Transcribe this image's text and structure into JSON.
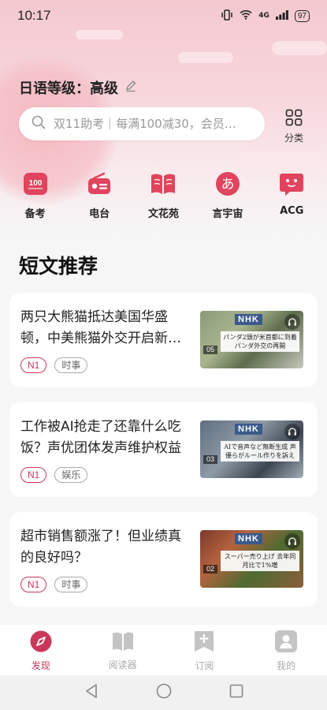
{
  "status_bar": {
    "time": "10:17",
    "network": "4G",
    "battery": "97"
  },
  "level": {
    "label": "日语等级：高级"
  },
  "search": {
    "placeholder": "双11助考｜每满100减30，会员…"
  },
  "category_button": {
    "label": "分类"
  },
  "quick_actions": [
    {
      "label": "备考",
      "icon": "exam-100-icon",
      "glyph": "100"
    },
    {
      "label": "电台",
      "icon": "radio-icon"
    },
    {
      "label": "文花苑",
      "icon": "book-icon"
    },
    {
      "label": "言宇宙",
      "icon": "hiragana-a-icon",
      "glyph": "あ"
    },
    {
      "label": "ACG",
      "icon": "acg-face-icon"
    }
  ],
  "section_title": "短文推荐",
  "articles": [
    {
      "title": "两只大熊猫抵达美国华盛顿，中美熊猫外交开启新…",
      "level": "N1",
      "tag": "时事",
      "thumb_logo": "NHK",
      "thumb_caption": "パンダ2頭が米首都に到着 パンダ外交の再開",
      "thumb_date": "05"
    },
    {
      "title": "工作被AI抢走了还靠什么吃饭？声优团体发声维护权益",
      "level": "N1",
      "tag": "娱乐",
      "thumb_logo": "NHK",
      "thumb_caption": "AIで音声など無断生成 声優らがルール作りを訴え",
      "thumb_date": "03"
    },
    {
      "title": "超市销售额涨了！但业绩真的良好吗？",
      "level": "N1",
      "tag": "时事",
      "thumb_logo": "NHK",
      "thumb_caption": "スーパー売り上げ 去年同月比で1%増",
      "thumb_date": "02"
    }
  ],
  "tabbar": [
    {
      "label": "发现",
      "icon": "compass-icon",
      "active": true
    },
    {
      "label": "阅读器",
      "icon": "reader-icon",
      "active": false
    },
    {
      "label": "订阅",
      "icon": "subscribe-icon",
      "active": false
    },
    {
      "label": "我的",
      "icon": "profile-icon",
      "active": false
    }
  ],
  "colors": {
    "accent": "#c9385a",
    "icon_red": "#e0445e",
    "inactive": "#bbbbbb"
  }
}
